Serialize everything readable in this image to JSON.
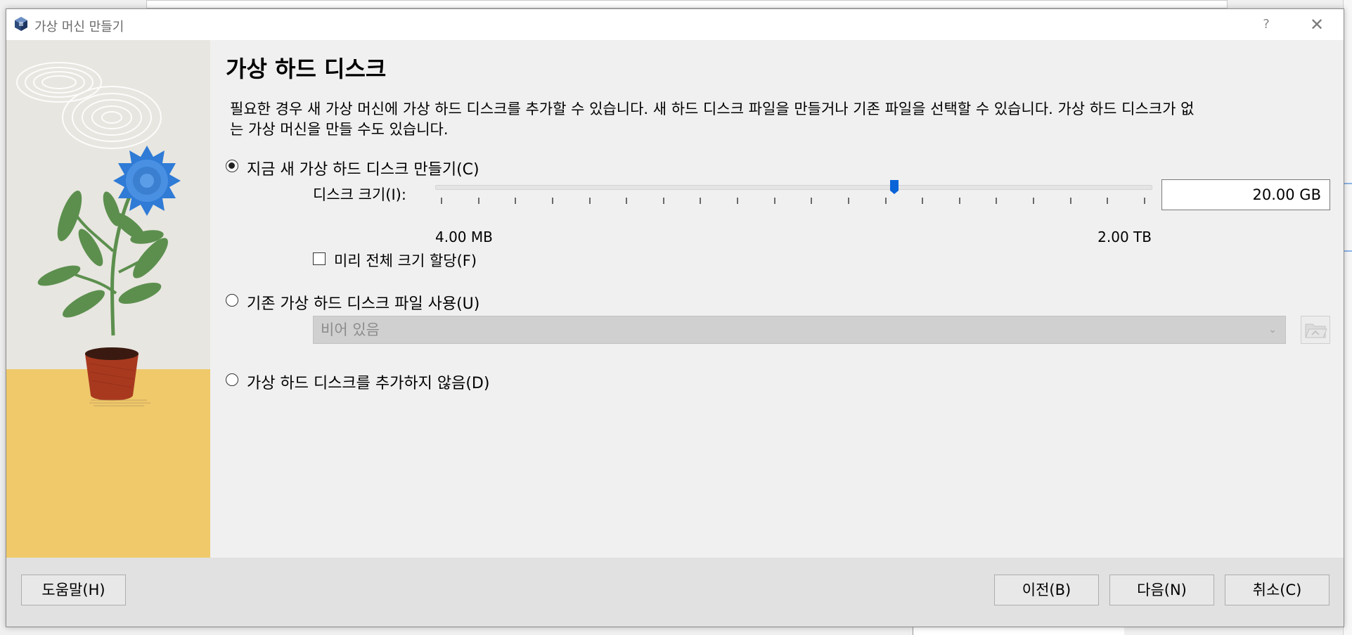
{
  "window": {
    "title": "가상 머신 만들기",
    "help_glyph": "?",
    "close_glyph": "✕"
  },
  "page": {
    "title": "가상 하드 디스크",
    "description": "필요한 경우 새 가상 머신에 가상 하드 디스크를 추가할 수 있습니다. 새 하드 디스크 파일을 만들거나 기존 파일을 선택할 수 있습니다. 가상 하드 디스크가 없는 가상 머신을 만들 수도 있습니다."
  },
  "options": {
    "create_new": {
      "label": "지금 새 가상 하드 디스크 만들기(C)",
      "selected": true
    },
    "use_existing": {
      "label": "기존 가상 하드 디스크 파일 사용(U)",
      "selected": false
    },
    "no_disk": {
      "label": "가상 하드 디스크를 추가하지 않음(D)",
      "selected": false
    }
  },
  "disk_size": {
    "label": "디스크 크기(I):",
    "value": "20.00 GB",
    "min_label": "4.00 MB",
    "max_label": "2.00 TB",
    "slider_fraction": 0.64,
    "tick_count": 20
  },
  "preallocate": {
    "label": "미리 전체 크기 할당(F)",
    "checked": false
  },
  "existing_file": {
    "placeholder": "비어 있음",
    "arrow_glyph": "⌄"
  },
  "buttons": {
    "help": "도움말(H)",
    "back": "이전(B)",
    "next": "다음(N)",
    "cancel": "취소(C)"
  },
  "colors": {
    "accent": "#0a64d8",
    "flower": "#2f7bd6",
    "leaf": "#5c8f4e",
    "pot": "#a8391f",
    "ground": "#efc96a",
    "wall": "#e8e6e0"
  },
  "icons": {
    "app": "virtualbox-cube-icon",
    "folder": "folder-open-icon"
  }
}
